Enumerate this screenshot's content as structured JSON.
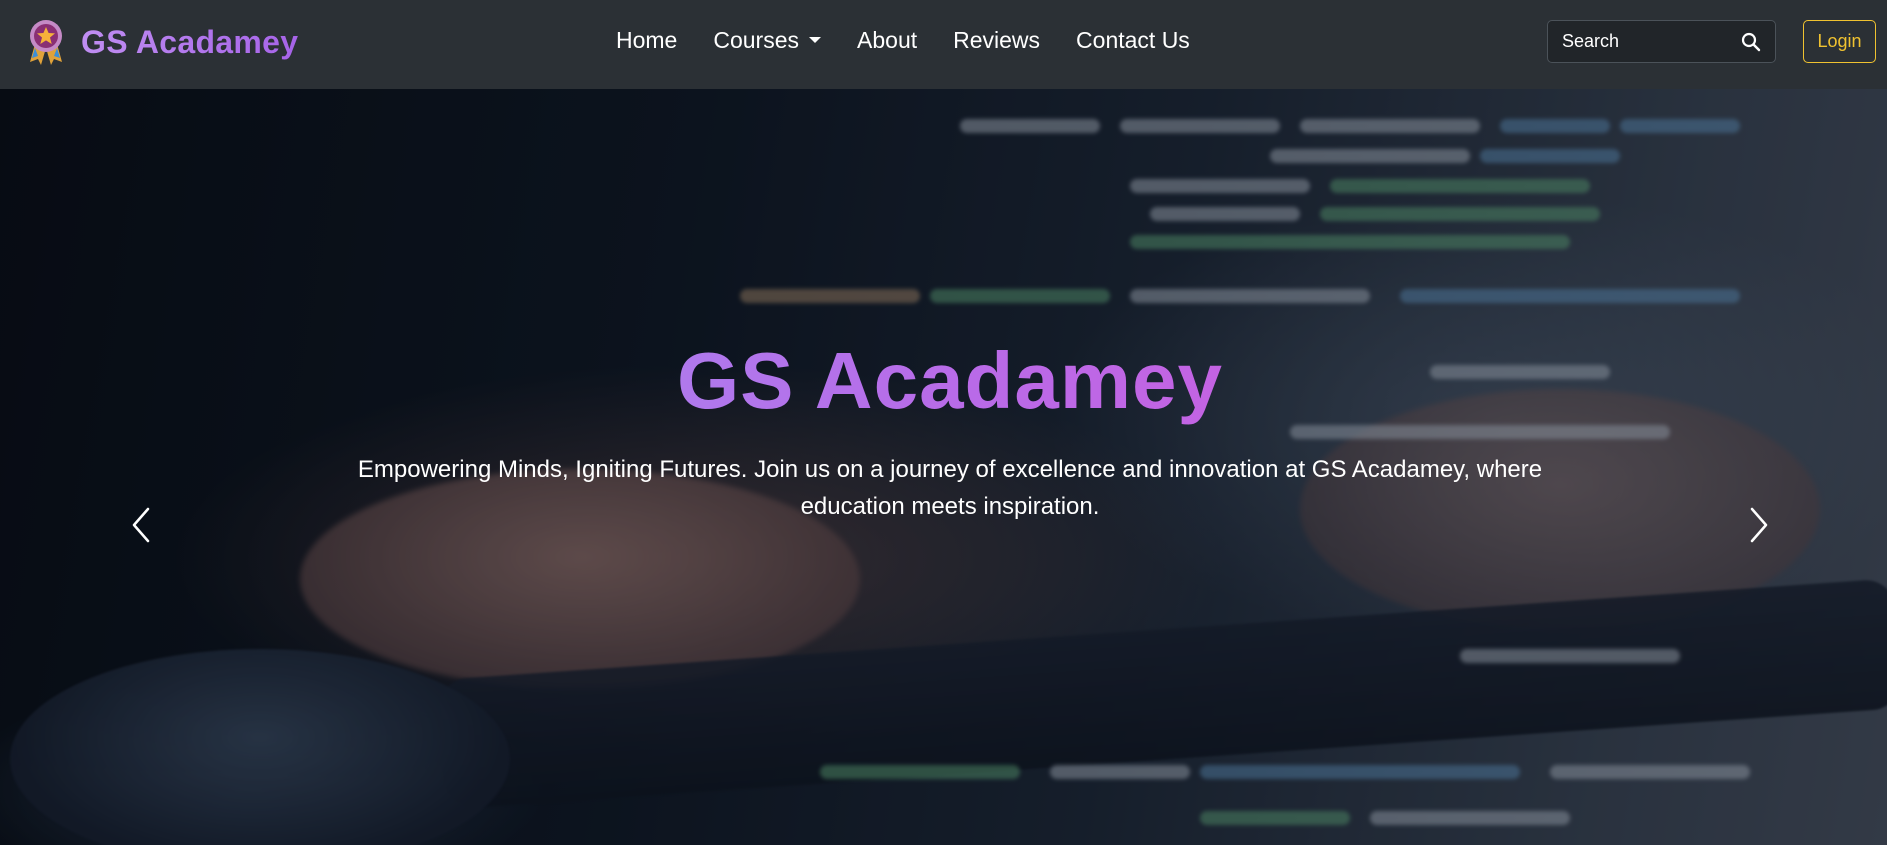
{
  "navbar": {
    "brand": "GS Acadamey",
    "links": [
      {
        "label": "Home"
      },
      {
        "label": "Courses",
        "has_dropdown": true
      },
      {
        "label": "About"
      },
      {
        "label": "Reviews"
      },
      {
        "label": "Contact Us"
      }
    ],
    "search": {
      "placeholder": "Search",
      "icon": "search-icon"
    },
    "login_label": "Login"
  },
  "hero": {
    "title": "GS Acadamey",
    "subtitle": "Empowering Minds, Igniting Futures. Join us on a journey of excellence and innovation at GS Acadamey, where education meets inspiration.",
    "prev_icon": "chevron-left-icon",
    "next_icon": "chevron-right-icon"
  },
  "colors": {
    "navbar_bg": "#2b3035",
    "brand_gradient": [
      "#c08ef2",
      "#a663e8"
    ],
    "title_gradient": [
      "#9a9cf8",
      "#b86be8",
      "#e04fd6"
    ],
    "login_accent": "#f0c230"
  }
}
